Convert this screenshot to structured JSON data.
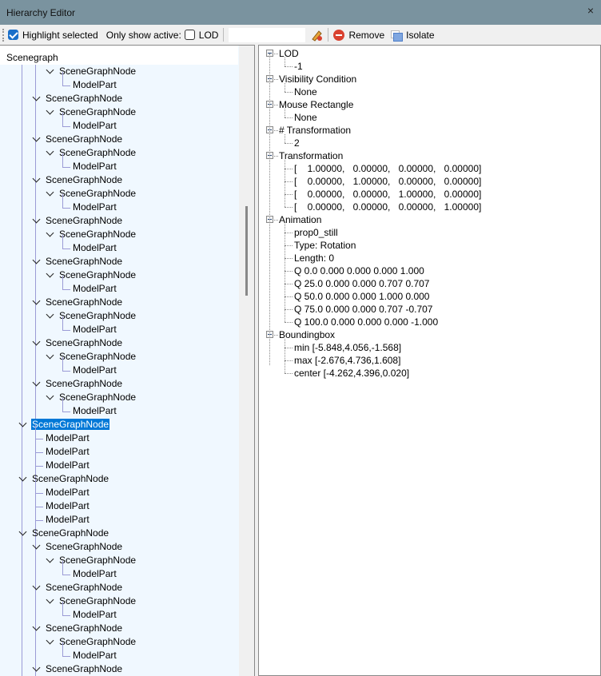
{
  "window": {
    "title": "Hierarchy Editor",
    "close": "×"
  },
  "toolbar": {
    "highlight_label": "Highlight selected",
    "highlight_checked": true,
    "only_show_active_label": "Only show active:",
    "lod_label": "LOD",
    "lod_checked": false,
    "search_value": "",
    "remove_label": "Remove",
    "isolate_label": "Isolate"
  },
  "scenegraph": {
    "header": "Scenegraph",
    "rows": [
      {
        "label": "SceneGraphNode",
        "depth": 2,
        "expandable": true
      },
      {
        "label": "ModelPart",
        "depth": 3
      },
      {
        "label": "SceneGraphNode",
        "depth": 1,
        "expandable": true
      },
      {
        "label": "SceneGraphNode",
        "depth": 2,
        "expandable": true
      },
      {
        "label": "ModelPart",
        "depth": 3
      },
      {
        "label": "SceneGraphNode",
        "depth": 1,
        "expandable": true
      },
      {
        "label": "SceneGraphNode",
        "depth": 2,
        "expandable": true
      },
      {
        "label": "ModelPart",
        "depth": 3
      },
      {
        "label": "SceneGraphNode",
        "depth": 1,
        "expandable": true
      },
      {
        "label": "SceneGraphNode",
        "depth": 2,
        "expandable": true
      },
      {
        "label": "ModelPart",
        "depth": 3
      },
      {
        "label": "SceneGraphNode",
        "depth": 1,
        "expandable": true
      },
      {
        "label": "SceneGraphNode",
        "depth": 2,
        "expandable": true
      },
      {
        "label": "ModelPart",
        "depth": 3
      },
      {
        "label": "SceneGraphNode",
        "depth": 1,
        "expandable": true
      },
      {
        "label": "SceneGraphNode",
        "depth": 2,
        "expandable": true
      },
      {
        "label": "ModelPart",
        "depth": 3
      },
      {
        "label": "SceneGraphNode",
        "depth": 1,
        "expandable": true
      },
      {
        "label": "SceneGraphNode",
        "depth": 2,
        "expandable": true
      },
      {
        "label": "ModelPart",
        "depth": 3
      },
      {
        "label": "SceneGraphNode",
        "depth": 1,
        "expandable": true
      },
      {
        "label": "SceneGraphNode",
        "depth": 2,
        "expandable": true
      },
      {
        "label": "ModelPart",
        "depth": 3
      },
      {
        "label": "SceneGraphNode",
        "depth": 1,
        "expandable": true
      },
      {
        "label": "SceneGraphNode",
        "depth": 2,
        "expandable": true
      },
      {
        "label": "ModelPart",
        "depth": 3
      },
      {
        "label": "SceneGraphNode",
        "depth": 0,
        "expandable": true,
        "selected": true
      },
      {
        "label": "ModelPart",
        "depth": 1
      },
      {
        "label": "ModelPart",
        "depth": 1
      },
      {
        "label": "ModelPart",
        "depth": 1
      },
      {
        "label": "SceneGraphNode",
        "depth": 0,
        "expandable": true
      },
      {
        "label": "ModelPart",
        "depth": 1
      },
      {
        "label": "ModelPart",
        "depth": 1
      },
      {
        "label": "ModelPart",
        "depth": 1
      },
      {
        "label": "SceneGraphNode",
        "depth": 0,
        "expandable": true
      },
      {
        "label": "SceneGraphNode",
        "depth": 1,
        "expandable": true
      },
      {
        "label": "SceneGraphNode",
        "depth": 2,
        "expandable": true
      },
      {
        "label": "ModelPart",
        "depth": 3
      },
      {
        "label": "SceneGraphNode",
        "depth": 1,
        "expandable": true
      },
      {
        "label": "SceneGraphNode",
        "depth": 2,
        "expandable": true
      },
      {
        "label": "ModelPart",
        "depth": 3
      },
      {
        "label": "SceneGraphNode",
        "depth": 1,
        "expandable": true
      },
      {
        "label": "SceneGraphNode",
        "depth": 2,
        "expandable": true
      },
      {
        "label": "ModelPart",
        "depth": 3
      },
      {
        "label": "SceneGraphNode",
        "depth": 1,
        "expandable": true
      }
    ]
  },
  "properties": [
    {
      "label": "LOD",
      "children": [
        "-1"
      ]
    },
    {
      "label": "Visibility Condition",
      "children": [
        "None"
      ]
    },
    {
      "label": "Mouse Rectangle",
      "children": [
        "None"
      ]
    },
    {
      "label": "# Transformation",
      "children": [
        "2"
      ]
    },
    {
      "label": "Transformation",
      "matrix": [
        [
          "1.00000,",
          "0.00000,",
          "0.00000,",
          "0.00000]"
        ],
        [
          "0.00000,",
          "1.00000,",
          "0.00000,",
          "0.00000]"
        ],
        [
          "0.00000,",
          "0.00000,",
          "1.00000,",
          "0.00000]"
        ],
        [
          "0.00000,",
          "0.00000,",
          "0.00000,",
          "1.00000]"
        ]
      ],
      "bracket": "["
    },
    {
      "label": "Animation",
      "children": [
        "prop0_still",
        "Type: Rotation",
        "Length: 0",
        "Q 0.0 0.000 0.000 0.000 1.000",
        "Q 25.0 0.000 0.000 0.707 0.707",
        "Q 50.0 0.000 0.000 1.000 0.000",
        "Q 75.0 0.000 0.000 0.707 -0.707",
        "Q 100.0 0.000 0.000 0.000 -1.000"
      ]
    },
    {
      "label": "Boundingbox",
      "children": [
        "min [-5.848,4.056,-1.568]",
        "max [-2.676,4.736,1.608]",
        "center [-4.262,4.396,0.020]"
      ]
    }
  ]
}
